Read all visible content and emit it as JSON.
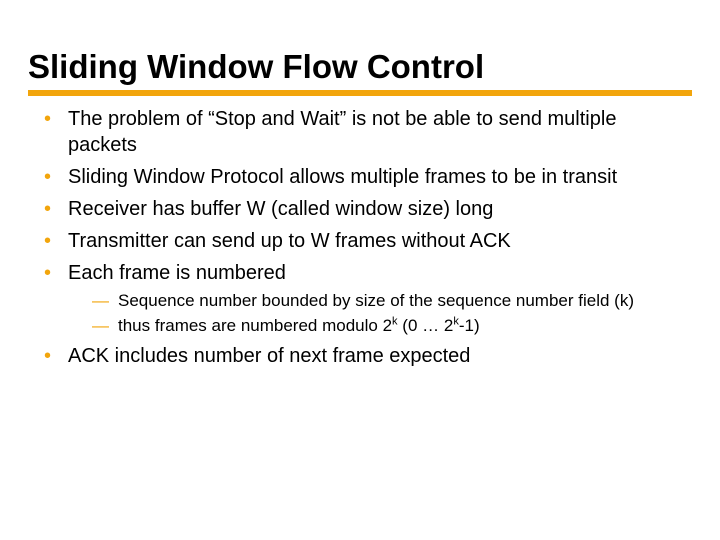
{
  "title": "Sliding Window Flow Control",
  "bullets": {
    "b1": "The problem of “Stop and Wait” is not be able to send multiple packets",
    "b2": "Sliding Window Protocol allows multiple frames to be in transit",
    "b3": "Receiver has buffer W (called window size) long",
    "b4": "Transmitter can send up to W frames without ACK",
    "b5": "Each frame is numbered",
    "b6": "ACK includes number of next frame expected"
  },
  "sub": {
    "s1_pre": "Sequence number bounded by size of the sequence number field (k)",
    "s2_pre": "thus frames are numbered modulo 2",
    "s2_sup1": "k",
    "s2_mid": " (0 … 2",
    "s2_sup2": "k",
    "s2_post": "-1)"
  },
  "colors": {
    "accent": "#f2a50c"
  }
}
